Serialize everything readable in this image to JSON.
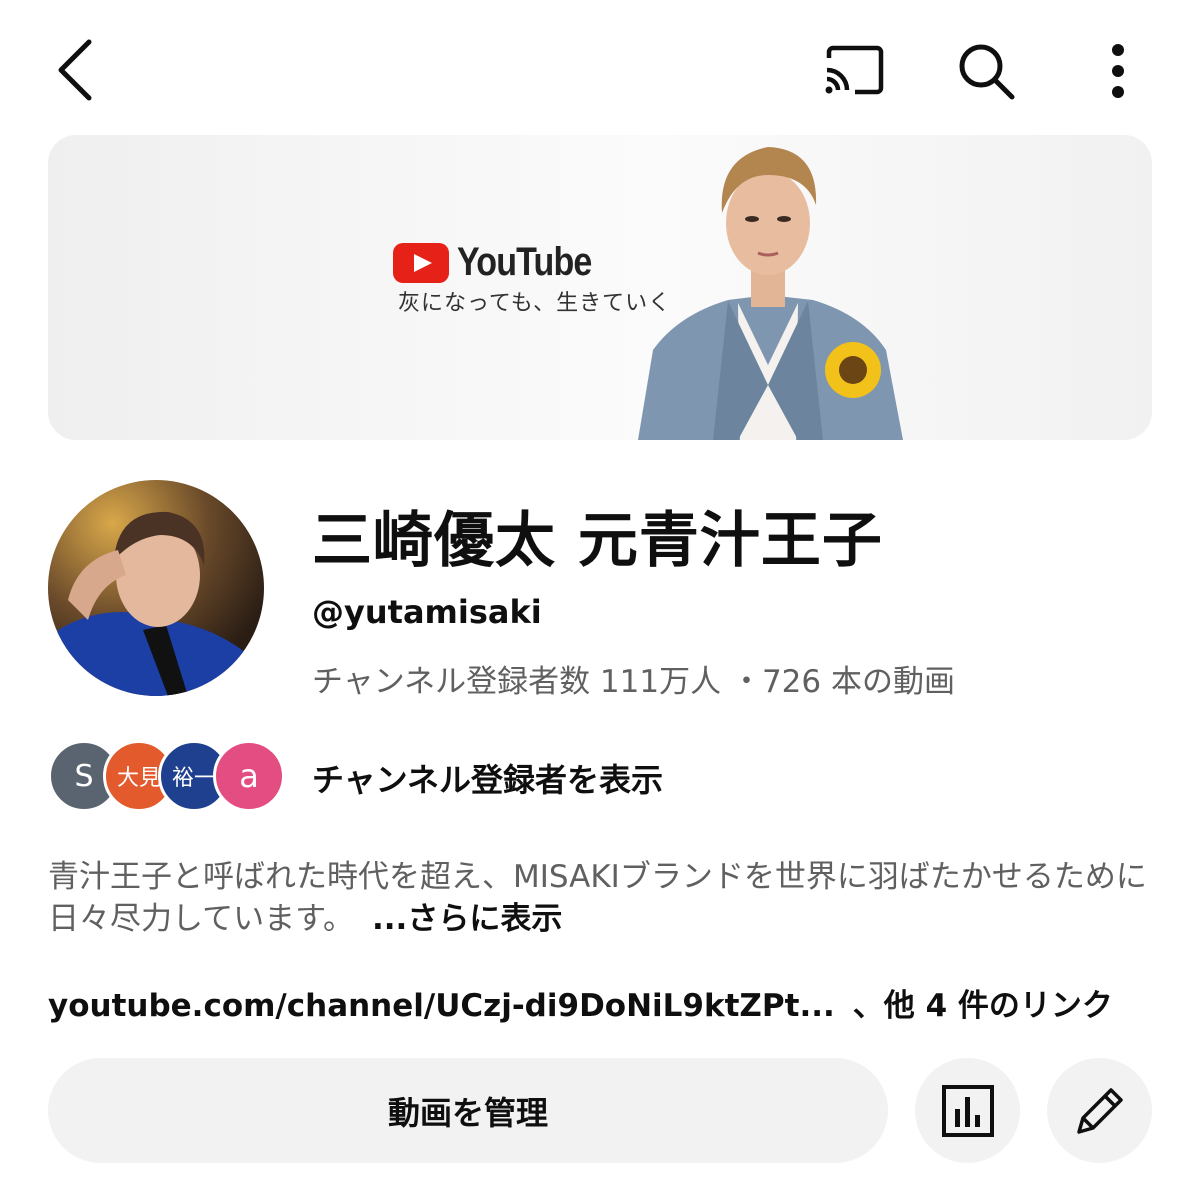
{
  "topbar": {
    "back_icon": "chevron-left-icon",
    "cast_icon": "cast-icon",
    "search_icon": "search-icon",
    "more_icon": "more-vertical-icon"
  },
  "banner": {
    "logo_text": "YouTube",
    "tagline": "灰になっても、生きていく"
  },
  "channel": {
    "name": "三崎優太 元青汁王子",
    "handle": "@yutamisaki",
    "stats": "チャンネル登録者数 111万人 ・726 本の動画"
  },
  "subscribers": {
    "avatars": [
      "S",
      "大見",
      "裕一",
      "a"
    ],
    "label": "チャンネル登録者を表示"
  },
  "description": {
    "text": "青汁王子と呼ばれた時代を超え、MISAKIブランドを世界に羽ばたかせるために日々尽力しています。",
    "more": "...さらに表示"
  },
  "links": {
    "primary": "youtube.com/channel/UCzj-di9DoNiL9ktZPt...",
    "others": "、他 4 件のリンク"
  },
  "actions": {
    "manage_label": "動画を管理",
    "analytics_icon": "analytics-icon",
    "edit_icon": "pencil-icon"
  },
  "colors": {
    "background": "#ffffff",
    "button_bg": "#f2f2f2",
    "secondary_text": "#606060",
    "youtube_red": "#e62117"
  }
}
